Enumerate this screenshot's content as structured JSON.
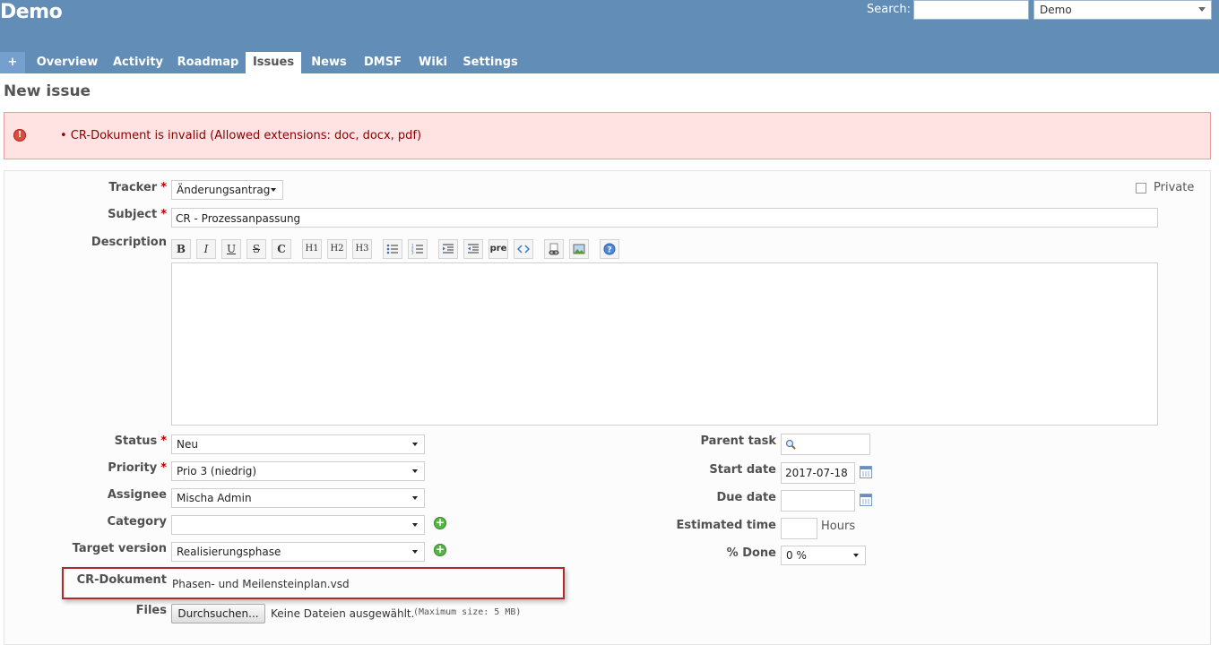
{
  "header": {
    "title": "Demo",
    "search_label": "Search:",
    "search_value": "",
    "project_select": "Demo"
  },
  "menu": {
    "tabs": [
      {
        "label": "+"
      },
      {
        "label": "Overview"
      },
      {
        "label": "Activity"
      },
      {
        "label": "Roadmap"
      },
      {
        "label": "Issues",
        "selected": true
      },
      {
        "label": "News"
      },
      {
        "label": "DMSF"
      },
      {
        "label": "Wiki"
      },
      {
        "label": "Settings"
      }
    ]
  },
  "page": {
    "title": "New issue"
  },
  "error": {
    "message": "• CR-Dokument is invalid (Allowed extensions: doc, docx, pdf)"
  },
  "form": {
    "tracker": {
      "label": "Tracker",
      "value": "Änderungsantrag"
    },
    "private_label": "Private",
    "subject": {
      "label": "Subject",
      "value": "CR - Prozessanpassung"
    },
    "description": {
      "label": "Description",
      "value": ""
    },
    "toolbar": [
      "B",
      "I",
      "U",
      "S",
      "C",
      "H1",
      "H2",
      "H3",
      "ul",
      "ol",
      "indent-right",
      "indent-left",
      "pre",
      "code",
      "link",
      "image",
      "help"
    ],
    "required_marker": "*",
    "status": {
      "label": "Status",
      "value": "Neu"
    },
    "priority": {
      "label": "Priority",
      "value": "Prio 3 (niedrig)"
    },
    "assignee": {
      "label": "Assignee",
      "value": "Mischa Admin"
    },
    "category": {
      "label": "Category",
      "value": ""
    },
    "target_version": {
      "label": "Target version",
      "value": "Realisierungsphase"
    },
    "cr_document": {
      "label": "CR-Dokument",
      "value": "Phasen- und Meilensteinplan.vsd"
    },
    "files": {
      "label": "Files",
      "button": "Durchsuchen...",
      "status": "Keine Dateien ausgewählt.",
      "hint": "(Maximum size: 5 MB)"
    },
    "parent_task": {
      "label": "Parent task",
      "value": ""
    },
    "start_date": {
      "label": "Start date",
      "value": "2017-07-18"
    },
    "due_date": {
      "label": "Due date",
      "value": ""
    },
    "estimated_time": {
      "label": "Estimated time",
      "value": "",
      "unit": "Hours"
    },
    "done": {
      "label": "% Done",
      "value": "0 %"
    }
  },
  "colors": {
    "header": "#628DB6",
    "error_bg": "#FFE3E3",
    "error_text": "#880000",
    "required": "#bb0000"
  }
}
